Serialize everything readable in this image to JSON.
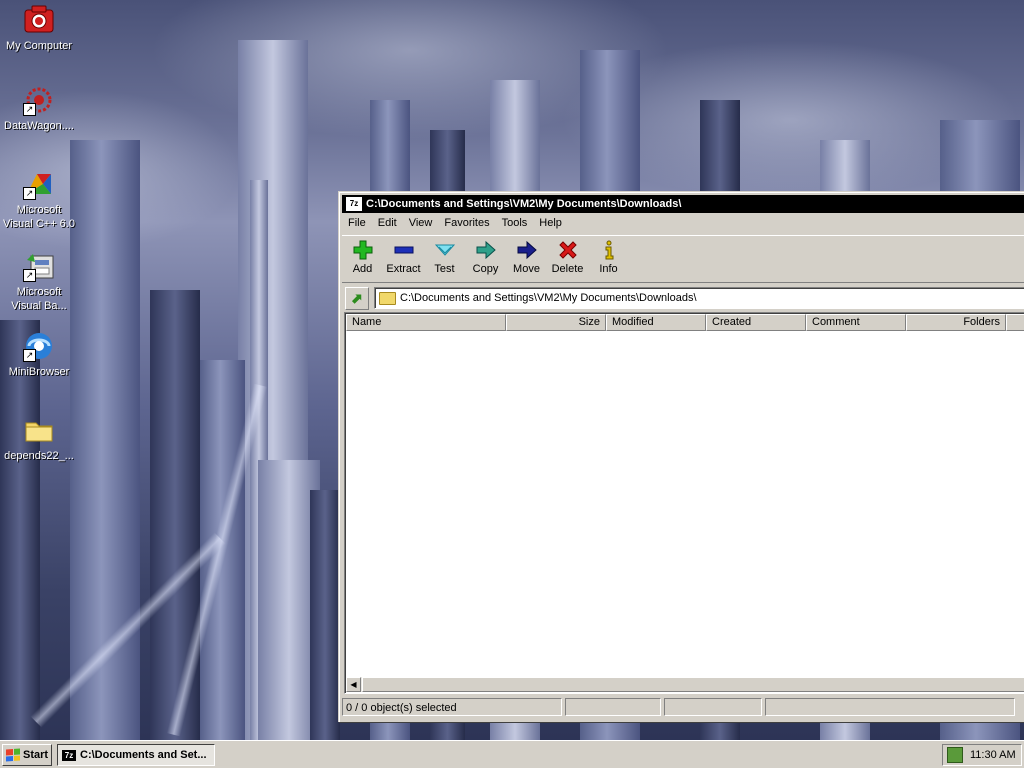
{
  "desktop": {
    "icons": [
      {
        "label": "My Computer",
        "icon": "camera-icon"
      },
      {
        "label": "DataWagon....",
        "icon": "datawagon-icon"
      },
      {
        "label": "Microsoft Visual C++ 6.0",
        "icon": "visual-cpp-icon"
      },
      {
        "label": "Microsoft Visual Ba...",
        "icon": "visual-basic-icon"
      },
      {
        "label": "MiniBrowser",
        "icon": "minibrowser-icon"
      },
      {
        "label": "depends22_...",
        "icon": "folder-icon"
      }
    ]
  },
  "window": {
    "title": "C:\\Documents and Settings\\VM2\\My Documents\\Downloads\\",
    "icon_text": "7z",
    "menu": [
      "File",
      "Edit",
      "View",
      "Favorites",
      "Tools",
      "Help"
    ],
    "toolbar": [
      {
        "label": "Add",
        "icon": "plus-icon",
        "color": "#1fae1f"
      },
      {
        "label": "Extract",
        "icon": "minus-icon",
        "color": "#1c2fb8"
      },
      {
        "label": "Test",
        "icon": "check-chevron-icon",
        "color": "#22b0c8"
      },
      {
        "label": "Copy",
        "icon": "arrow-right-icon",
        "color": "#1f8a7a"
      },
      {
        "label": "Move",
        "icon": "arrow-right-icon",
        "color": "#1a1f8c"
      },
      {
        "label": "Delete",
        "icon": "x-icon",
        "color": "#d01818"
      },
      {
        "label": "Info",
        "icon": "info-icon",
        "color": "#c8a800"
      }
    ],
    "address": "C:\\Documents and Settings\\VM2\\My Documents\\Downloads\\",
    "columns": [
      "Name",
      "Size",
      "Modified",
      "Created",
      "Comment",
      "Folders"
    ],
    "status": "0 / 0 object(s) selected"
  },
  "taskbar": {
    "start_label": "Start",
    "task_label": "C:\\Documents and Set...",
    "task_icon_text": "7z",
    "clock": "11:30 AM"
  }
}
